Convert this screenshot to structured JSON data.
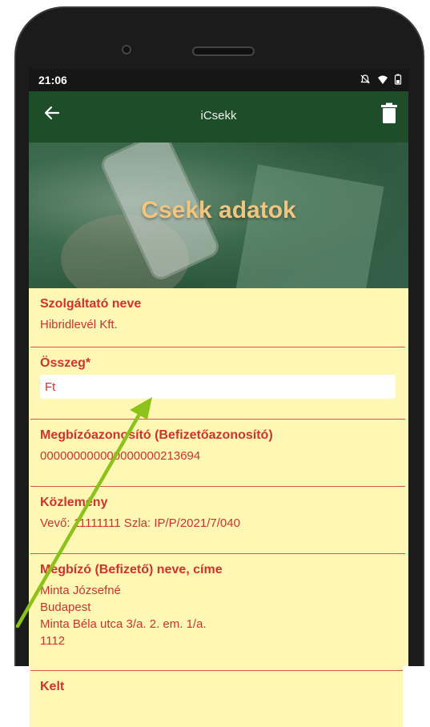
{
  "status_bar": {
    "time": "21:06",
    "icons": [
      "bell-off-icon",
      "wifi-icon",
      "battery-icon"
    ]
  },
  "app_bar": {
    "title": "iCsekk",
    "back_icon": "arrow-left-icon",
    "delete_icon": "trash-icon"
  },
  "hero": {
    "title": "Csekk adatok"
  },
  "fields": {
    "provider": {
      "label": "Szolgáltató neve",
      "value": "Hibridlevél Kft."
    },
    "amount": {
      "label": "Összeg*",
      "value": "Ft"
    },
    "payer_id": {
      "label": "Megbízóazonosító (Befizetőazonosító)",
      "value": "000000000000000000213694"
    },
    "notice": {
      "label": "Közlemény",
      "value": "Vevő: 11111111 Szla: IP/P/2021/7/040"
    },
    "payer": {
      "label": "Megbízó (Befizető) neve, címe",
      "lines": [
        "Minta Józsefné",
        "Budapest",
        "Minta Béla utca 3/a. 2. em. 1/a.",
        "1112"
      ]
    },
    "date": {
      "label": "Kelt"
    }
  },
  "colors": {
    "app_bar": "#1e4d29",
    "content_bg": "#fff8b5",
    "label_red": "#d3312b",
    "hero_title": "#f2c57e",
    "annotation_arrow": "#8cc21a"
  }
}
